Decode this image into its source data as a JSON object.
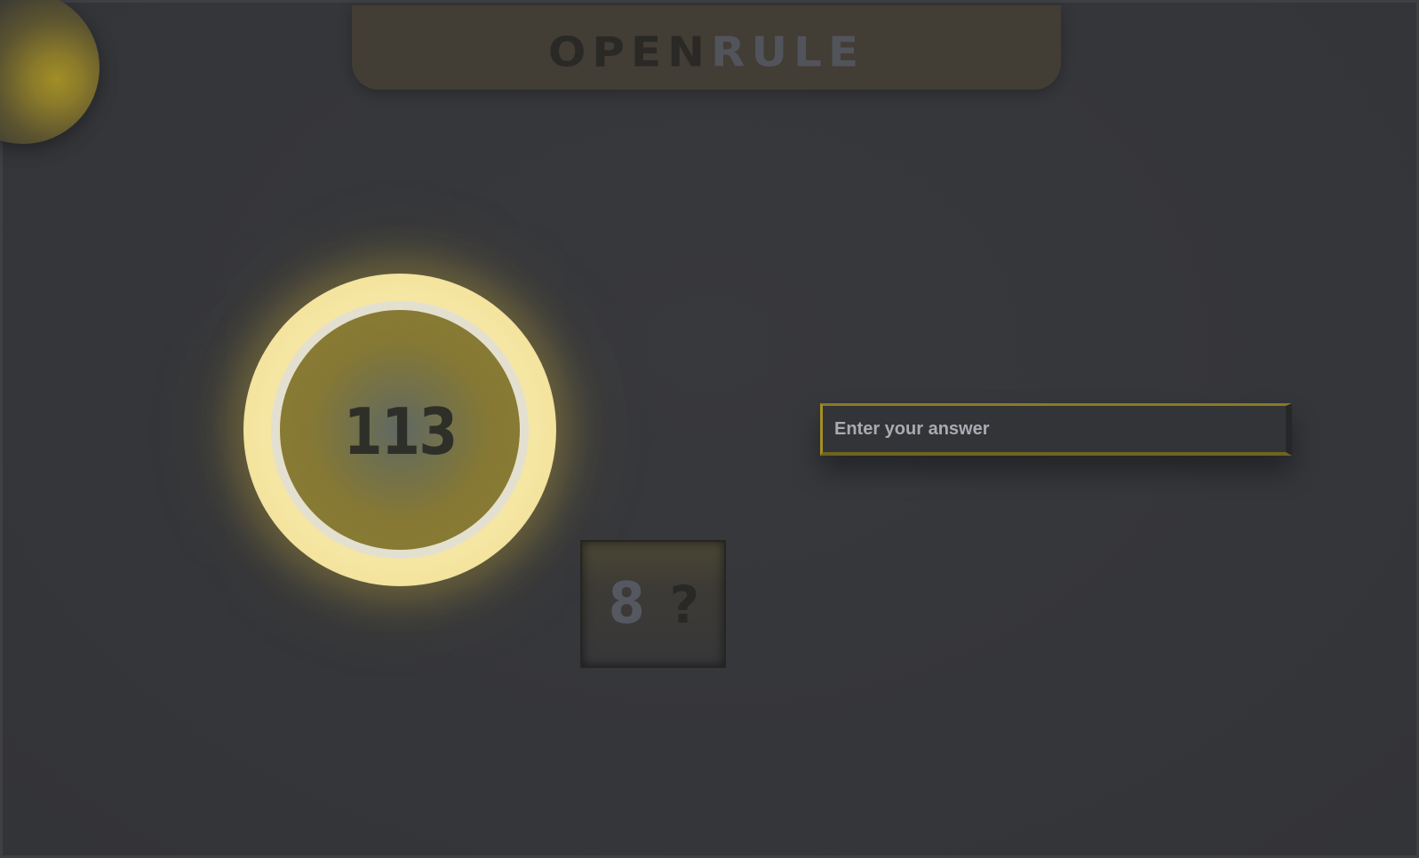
{
  "header": {
    "logo_part1": "OPEN",
    "logo_part2": "RULE"
  },
  "dial": {
    "value": "113"
  },
  "answer": {
    "placeholder": "Enter your answer",
    "value": ""
  },
  "clue": {
    "value": "8",
    "unknown": "?"
  },
  "colors": {
    "background": "#35363a",
    "accent_gold": "#a38f25",
    "dial_glow": "#f5e6a3",
    "banner": "#423d35"
  }
}
